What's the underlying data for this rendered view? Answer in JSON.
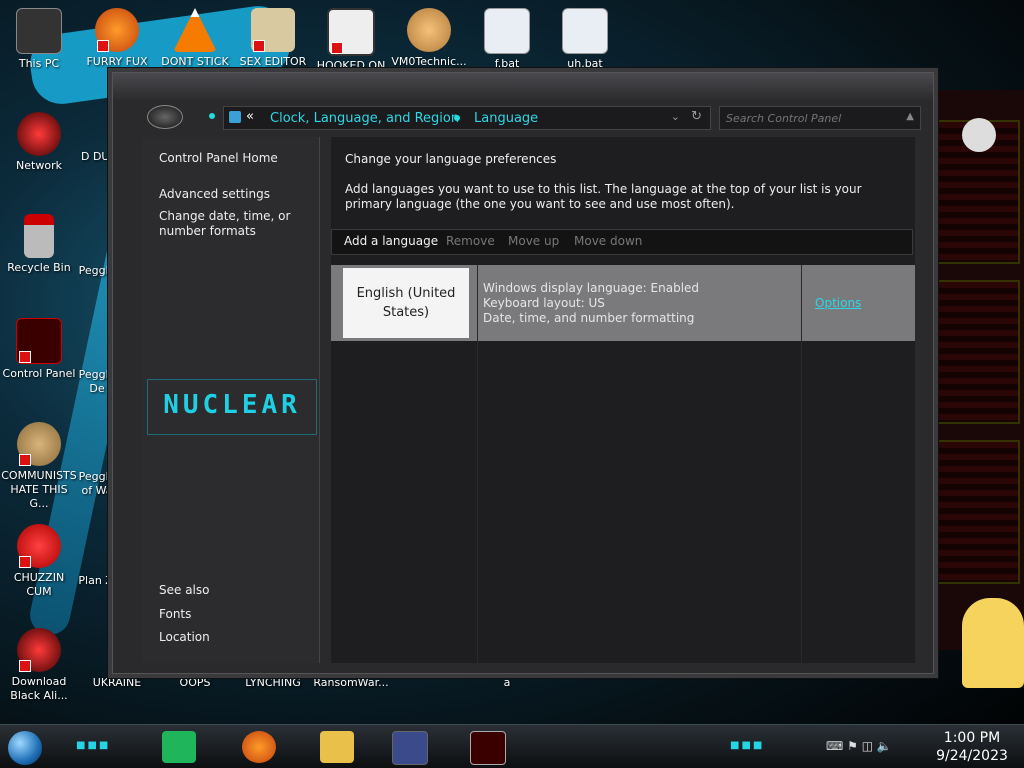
{
  "desktop": {
    "icons": [
      {
        "label": "This PC"
      },
      {
        "label": "FURRY FUX"
      },
      {
        "label": "DONT STICK"
      },
      {
        "label": "SEX EDITOR"
      },
      {
        "label": "HOOKED ON"
      },
      {
        "label": "VM0Technic..."
      },
      {
        "label": "f.bat"
      },
      {
        "label": "uh.bat"
      },
      {
        "label": "Network"
      },
      {
        "label": "Recycle Bin"
      },
      {
        "label": "Control Panel"
      },
      {
        "label": "COMMUNISTS HATE THIS G..."
      },
      {
        "label": "CHUZZIN CUM"
      },
      {
        "label": "Download Black Ali..."
      },
      {
        "label": "D DUM"
      },
      {
        "label": "Peggle"
      },
      {
        "label": "Peggle De"
      },
      {
        "label": "Peggle of Wa"
      },
      {
        "label": "Plan Zo"
      },
      {
        "label": "UKRAINE"
      },
      {
        "label": "OOPS"
      },
      {
        "label": "LYNCHING"
      },
      {
        "label": "RansomWar..."
      },
      {
        "label": "a"
      }
    ]
  },
  "window": {
    "address": {
      "crumb1": "Clock, Language, and Region",
      "crumb2": "Language",
      "chevron": "«"
    },
    "search": {
      "placeholder": "Search Control Panel"
    },
    "left_pane": {
      "home": "Control Panel Home",
      "advanced": "Advanced settings",
      "change_formats": "Change date, time, or number formats",
      "logo_text": "NUCLEAR",
      "see_also": "See also",
      "fonts": "Fonts",
      "location": "Location"
    },
    "main": {
      "title": "Change your language preferences",
      "description": "Add languages you want to use to this list. The language at the top of your list is your primary language (the one you want to see and use most often).",
      "toolbar": {
        "add": "Add a language",
        "remove": "Remove",
        "move_up": "Move up",
        "move_down": "Move down"
      },
      "languages": [
        {
          "name": "English (United States)",
          "line1": "Windows display language: Enabled",
          "line2": "Keyboard layout: US",
          "line3": "Date, time, and number formatting",
          "options": "Options"
        }
      ]
    }
  },
  "taskbar": {
    "time": "1:00 PM",
    "date": "9/24/2023"
  },
  "colors": {
    "accent": "#2ed7e6",
    "window_bg": "#2a2a2c",
    "main_bg": "#1e1e20",
    "selected_row": "#7a7a7c"
  }
}
